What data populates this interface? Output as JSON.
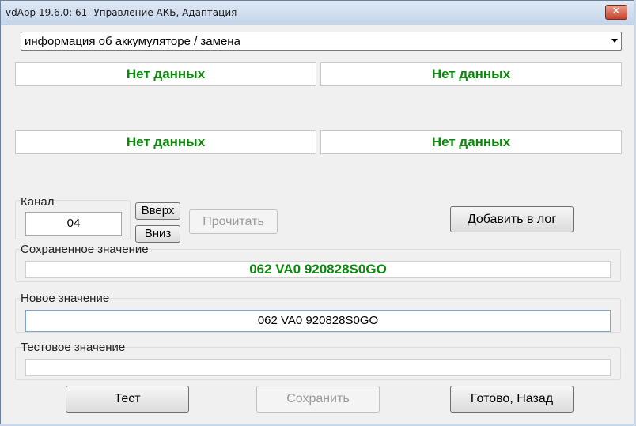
{
  "window": {
    "title": "vdApp 19.6.0: 61- Управление АКБ, Адаптация",
    "close_glyph": "✕"
  },
  "selector": {
    "value": "информация об аккумуляторе / замена"
  },
  "data_boxes": [
    "Нет данных",
    "Нет данных",
    "Нет данных",
    "Нет данных"
  ],
  "channel": {
    "label": "Канал",
    "value": "04",
    "up_label": "Вверх",
    "down_label": "Вниз",
    "read_label": "Прочитать"
  },
  "add_log_label": "Добавить в лог",
  "saved": {
    "label": "Сохраненное значение",
    "value": "062 VA0 920828S0GO"
  },
  "new_value": {
    "label": "Новое значение",
    "value": "062 VA0 920828S0GO"
  },
  "test_value": {
    "label": "Тестовое значение",
    "value": ""
  },
  "buttons": {
    "test": "Тест",
    "save": "Сохранить",
    "done": "Готово, Назад"
  }
}
